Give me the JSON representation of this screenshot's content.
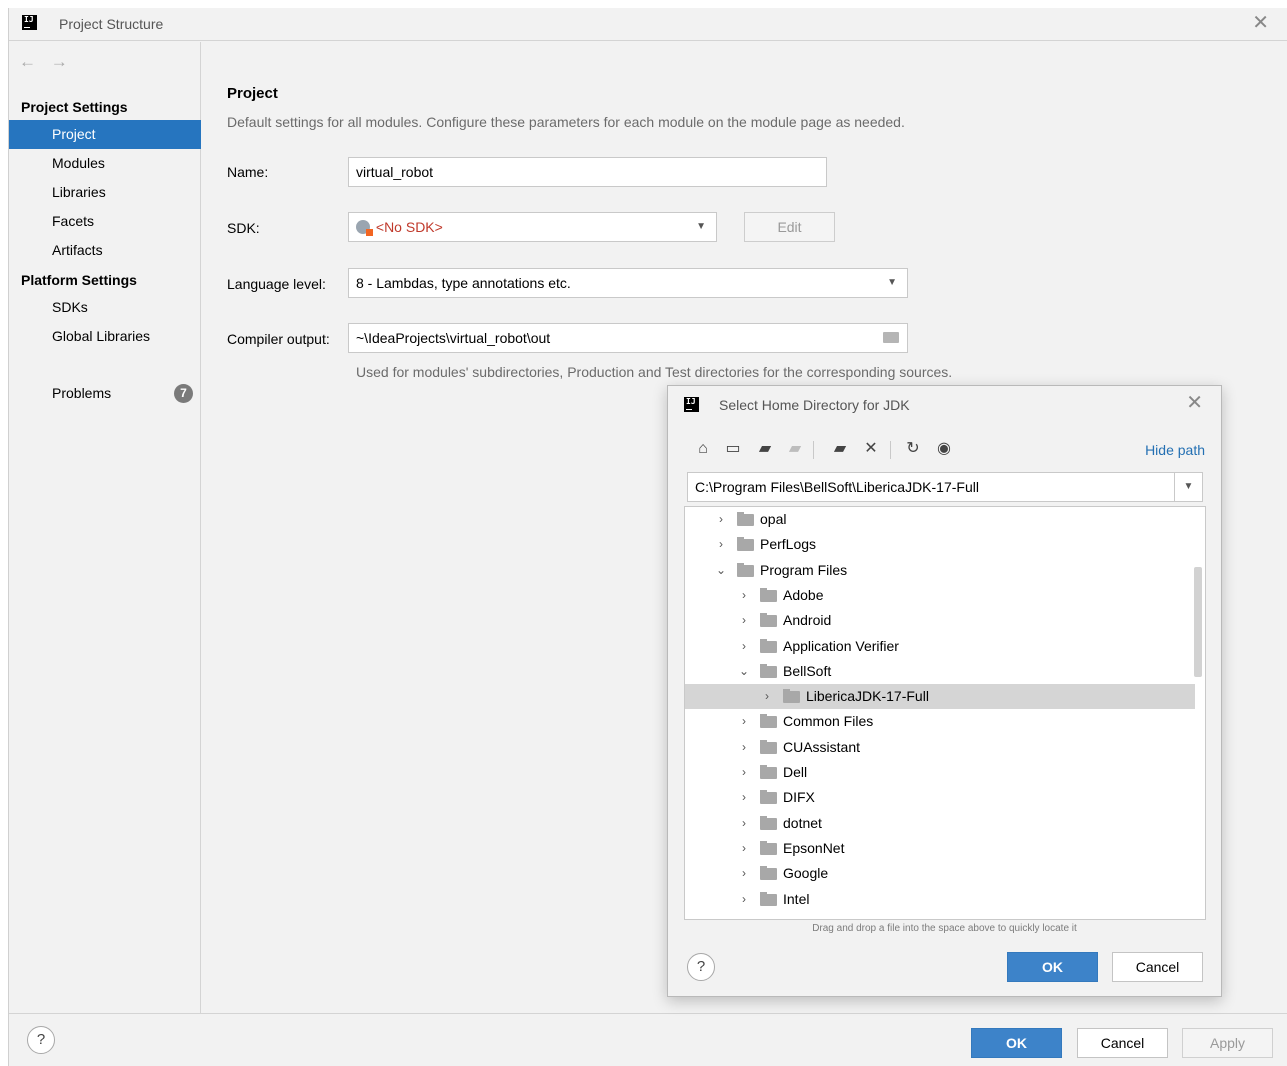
{
  "window": {
    "title": "Project Structure",
    "icon_text": "IJ"
  },
  "sidebar": {
    "back_arrow": "←",
    "forward_arrow": "→",
    "project_settings_title": "Project Settings",
    "project_items": [
      "Project",
      "Modules",
      "Libraries",
      "Facets",
      "Artifacts"
    ],
    "platform_settings_title": "Platform Settings",
    "platform_items": [
      "SDKs",
      "Global Libraries"
    ],
    "problems_label": "Problems",
    "problems_count": "7"
  },
  "project": {
    "heading": "Project",
    "description": "Default settings for all modules. Configure these parameters for each module on the module page as needed.",
    "name_label": "Name:",
    "name_value": "virtual_robot",
    "sdk_label": "SDK:",
    "sdk_value": "<No SDK>",
    "edit_label": "Edit",
    "language_label": "Language level:",
    "language_value": "8 - Lambdas, type annotations etc.",
    "compiler_label": "Compiler output:",
    "compiler_value": "~\\IdeaProjects\\virtual_robot\\out",
    "compiler_hint": "Used for modules' subdirectories, Production and Test directories for the corresponding sources."
  },
  "dialog": {
    "title": "Select Home Directory for JDK",
    "hide_path_label": "Hide path",
    "path_value": "C:\\Program Files\\BellSoft\\LibericaJDK-17-Full",
    "toolbar_icons": [
      "home-icon",
      "desktop-icon",
      "project-folder-icon",
      "module-folder-icon",
      "new-folder-icon",
      "delete-icon",
      "refresh-icon",
      "show-hidden-icon"
    ],
    "tree": [
      {
        "name": "opal",
        "level": 1,
        "expanded": false
      },
      {
        "name": "PerfLogs",
        "level": 1,
        "expanded": false
      },
      {
        "name": "Program Files",
        "level": 1,
        "expanded": true
      },
      {
        "name": "Adobe",
        "level": 2,
        "expanded": false
      },
      {
        "name": "Android",
        "level": 2,
        "expanded": false
      },
      {
        "name": "Application Verifier",
        "level": 2,
        "expanded": false
      },
      {
        "name": "BellSoft",
        "level": 2,
        "expanded": true
      },
      {
        "name": "LibericaJDK-17-Full",
        "level": 3,
        "expanded": false,
        "selected": true
      },
      {
        "name": "Common Files",
        "level": 2,
        "expanded": false
      },
      {
        "name": "CUAssistant",
        "level": 2,
        "expanded": false
      },
      {
        "name": "Dell",
        "level": 2,
        "expanded": false
      },
      {
        "name": "DIFX",
        "level": 2,
        "expanded": false
      },
      {
        "name": "dotnet",
        "level": 2,
        "expanded": false
      },
      {
        "name": "EpsonNet",
        "level": 2,
        "expanded": false
      },
      {
        "name": "Google",
        "level": 2,
        "expanded": false
      },
      {
        "name": "Intel",
        "level": 2,
        "expanded": false
      }
    ],
    "drag_hint": "Drag and drop a file into the space above to quickly locate it",
    "ok_label": "OK",
    "cancel_label": "Cancel"
  },
  "footer": {
    "ok_label": "OK",
    "cancel_label": "Cancel",
    "apply_label": "Apply"
  },
  "colors": {
    "accent": "#2675bf",
    "primary_button": "#3d83c9",
    "error_text": "#c0392b",
    "link": "#2470b3"
  }
}
